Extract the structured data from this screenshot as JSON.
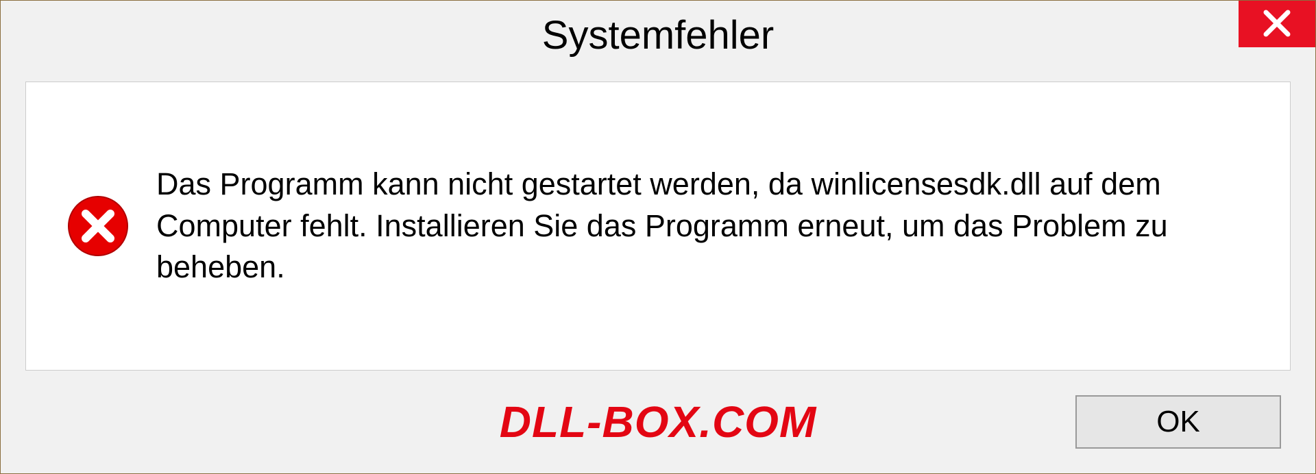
{
  "dialog": {
    "title": "Systemfehler",
    "message": "Das Programm kann nicht gestartet werden, da winlicensesdk.dll auf dem Computer fehlt. Installieren Sie das Programm erneut, um das Problem zu beheben.",
    "ok_label": "OK"
  },
  "watermark": "DLL-BOX.COM"
}
